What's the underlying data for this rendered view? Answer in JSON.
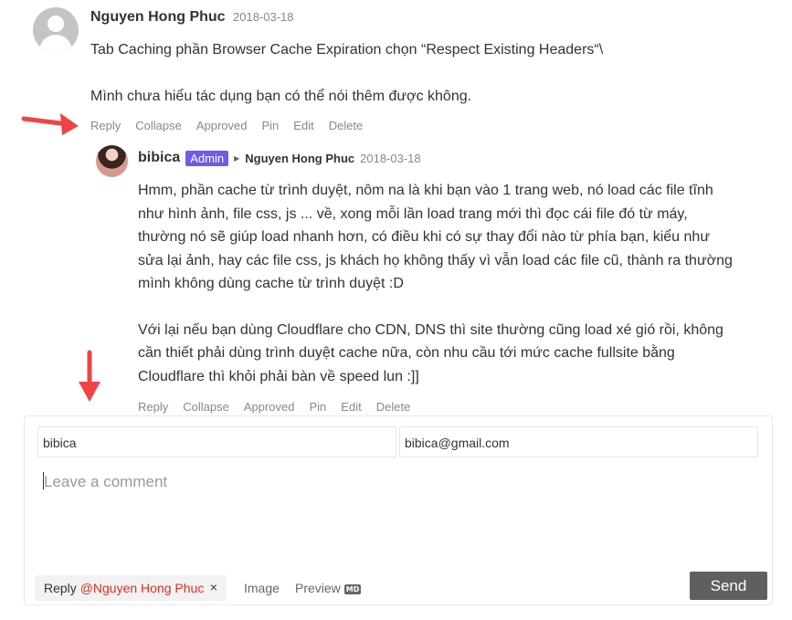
{
  "comments": [
    {
      "author": "Nguyen Hong Phuc",
      "date": "2018-03-18",
      "line1": "Tab Caching phần Browser Cache Expiration chọn “Respect Existing Headers“\\",
      "line2": "Mình chưa hiểu tác dụng bạn có thể nói thêm được không."
    },
    {
      "author": "bibica",
      "badge": "Admin",
      "reply_to": "Nguyen Hong Phuc",
      "date": "2018-03-18",
      "para1": [
        "Hmm, phần cache từ trình duyệt, nôm na là khi bạn vào 1 trang web, nó load các file tĩnh",
        "như hình ảnh, file css, js ... về, xong mỗi lần load trang mới thì đọc cái file đó từ máy,",
        "thường nó sẽ giúp load nhanh hơn, có điều khi có sự thay đổi nào từ phía bạn, kiểu như",
        "sửa lại ảnh, hay các file css, js khách họ không thấy vì vẫn load các file cũ, thành ra thường",
        "mình không dùng cache từ trình duyệt :D"
      ],
      "para2": [
        "Với lại nếu bạn dùng Cloudflare cho CDN, DNS thì site thường cũng load xé gió rồi, không",
        "cần thiết phải dùng trình duyệt cache nữa, còn nhu cầu tới mức cache fullsite bằng",
        "Cloudflare thì khỏi phải bàn về speed lun :]]"
      ]
    }
  ],
  "actions": [
    "Reply",
    "Collapse",
    "Approved",
    "Pin",
    "Edit",
    "Delete"
  ],
  "form": {
    "name_value": "bibica",
    "email_value": "bibica@gmail.com",
    "comment_placeholder": "Leave a comment",
    "reply_label": "Reply",
    "reply_mention": "@Nguyen Hong Phuc",
    "reply_close": "×",
    "image_label": "Image",
    "preview_label": "Preview",
    "markdown_icon": "MD",
    "send_label": "Send"
  },
  "colors": {
    "admin_badge": "#6c5ce7",
    "mention": "#d93025",
    "send_button": "#5f5f5f",
    "annotation_arrow": "#ef4444"
  }
}
